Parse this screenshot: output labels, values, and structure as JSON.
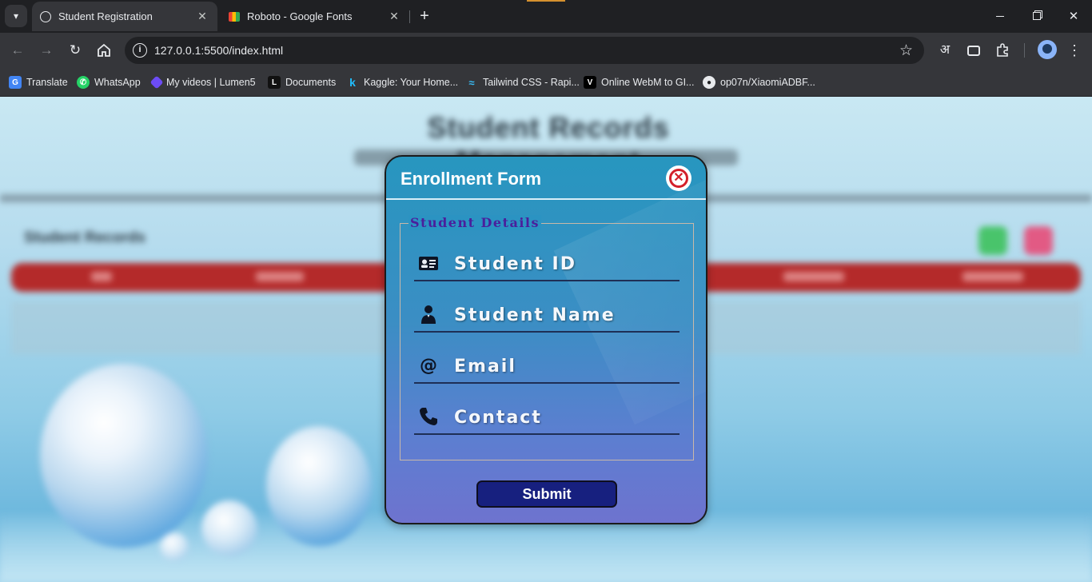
{
  "browser": {
    "tabs": [
      {
        "label": "Student Registration",
        "active": true
      },
      {
        "label": "Roboto - Google Fonts",
        "active": false
      }
    ],
    "url": "127.0.0.1:5500/index.html",
    "bookmarks": [
      {
        "label": "Translate"
      },
      {
        "label": "WhatsApp"
      },
      {
        "label": "My videos | Lumen5"
      },
      {
        "label": "Documents"
      },
      {
        "label": "Kaggle: Your Home..."
      },
      {
        "label": "Tailwind CSS - Rapi..."
      },
      {
        "label": "Online WebM to GI..."
      },
      {
        "label": "op07n/XiaomiADBF..."
      }
    ],
    "hindi_icon": "अ",
    "tab_close_glyph": "✕",
    "new_tab_glyph": "+"
  },
  "background_page": {
    "title": "Student Records Management",
    "records_heading": "Student Records"
  },
  "modal": {
    "title": "Enrollment Form",
    "legend": "Student Details",
    "fields": [
      {
        "label": "Student ID",
        "icon": "id-card-icon"
      },
      {
        "label": "Student Name",
        "icon": "person-icon"
      },
      {
        "label": "Email",
        "icon": "at-sign-icon"
      },
      {
        "label": "Contact",
        "icon": "phone-icon"
      }
    ],
    "submit_label": "Submit",
    "close_glyph": "✕"
  },
  "colors": {
    "modal_top": "#2796bf",
    "modal_bottom": "#6e73cf",
    "legend_text": "#4a1f9c",
    "submit_bg": "#17207f",
    "close_red": "#d3202b",
    "table_header": "#b42a2a"
  }
}
